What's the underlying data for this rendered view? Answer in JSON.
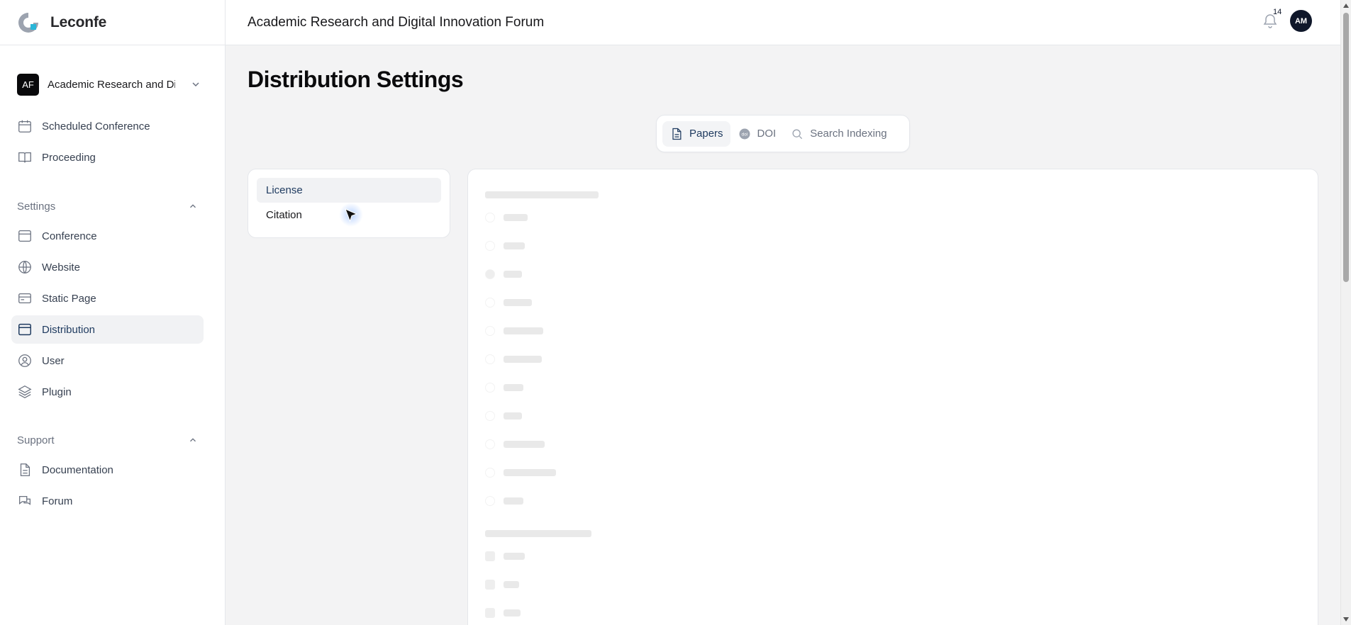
{
  "app": {
    "brand": "Leconfe",
    "header_title": "Academic Research and Digital Innovation Forum",
    "notification_count": "14",
    "user_initials": "AM"
  },
  "sidebar": {
    "conference_badge": "AF",
    "conference_name": "Academic Research and Digital Innovation Forum",
    "top_items": [
      {
        "label": "Scheduled Conference",
        "icon": "calendar-icon"
      },
      {
        "label": "Proceeding",
        "icon": "book-open-icon"
      }
    ],
    "settings_label": "Settings",
    "settings_items": [
      {
        "label": "Conference",
        "icon": "window-icon"
      },
      {
        "label": "Website",
        "icon": "globe-icon"
      },
      {
        "label": "Static Page",
        "icon": "card-icon"
      },
      {
        "label": "Distribution",
        "icon": "window-icon",
        "active": true
      },
      {
        "label": "User",
        "icon": "user-circle-icon"
      },
      {
        "label": "Plugin",
        "icon": "layers-icon"
      }
    ],
    "support_label": "Support",
    "support_items": [
      {
        "label": "Documentation",
        "icon": "document-icon"
      },
      {
        "label": "Forum",
        "icon": "chat-bubbles-icon"
      }
    ]
  },
  "main": {
    "title": "Distribution Settings",
    "tabs": [
      {
        "label": "Papers",
        "active": true
      },
      {
        "label": "DOI",
        "active": false
      },
      {
        "label": "Search Indexing",
        "active": false
      }
    ],
    "subnav": [
      {
        "label": "License",
        "active": true
      },
      {
        "label": "Citation",
        "active": false
      }
    ]
  },
  "colors": {
    "accent": "#1e3a5f",
    "active_bg": "#f1f2f4",
    "page_bg": "#f3f3f4",
    "logo_accent": "#29b6d8"
  }
}
